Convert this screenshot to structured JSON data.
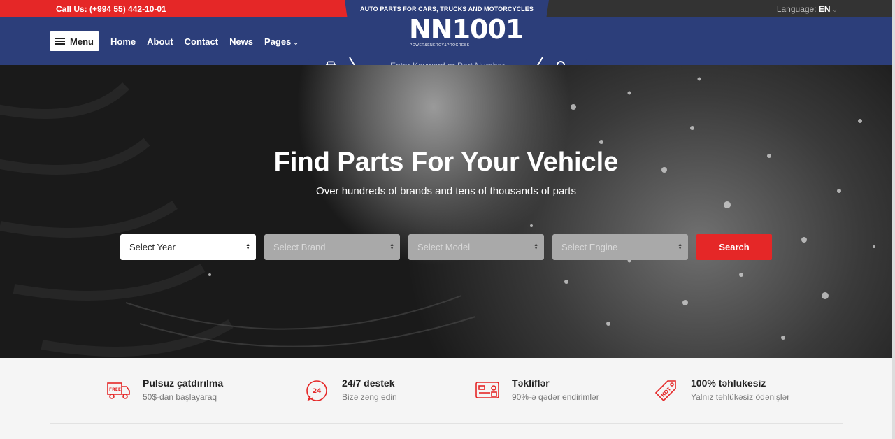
{
  "topbar": {
    "phone": "Call Us: (+994 55) 442-10-01",
    "tagline": "AUTO PARTS FOR CARS, TRUCKS AND MOTORCYCLES",
    "language_label": "Language:",
    "language_value": "EN"
  },
  "logo": {
    "text": "NN1001",
    "subtitle": "POWER&ENERGY&PROGRESS"
  },
  "nav": {
    "menu_label": "Menu",
    "links": [
      "Home",
      "About",
      "Contact",
      "News",
      "Pages"
    ]
  },
  "search": {
    "placeholder": "Enter Keyword or Part Number"
  },
  "hero": {
    "title": "Find Parts For Your Vehicle",
    "subtitle": "Over hundreds of brands and tens of thousands of parts",
    "selects": [
      "Select Year",
      "Select Brand",
      "Select Model",
      "Select Engine"
    ],
    "button": "Search"
  },
  "features": [
    {
      "icon": "free-delivery-truck-icon",
      "title": "Pulsuz çatdırılma",
      "text": "50$-dan başlayaraq"
    },
    {
      "icon": "support-24-7-icon",
      "title": "24/7 destek",
      "text": "Bizə zəng edin"
    },
    {
      "icon": "offers-card-icon",
      "title": "Təkliflər",
      "text": "90%-ə qədər endirimlər"
    },
    {
      "icon": "hot-price-tag-icon",
      "title": "100% təhlukesiz",
      "text": "Yalnız təhlükəsiz ödənişlər"
    }
  ],
  "colors": {
    "brand_blue": "#2c3e7a",
    "accent_red": "#e52727",
    "topbar_dark": "#333333"
  }
}
